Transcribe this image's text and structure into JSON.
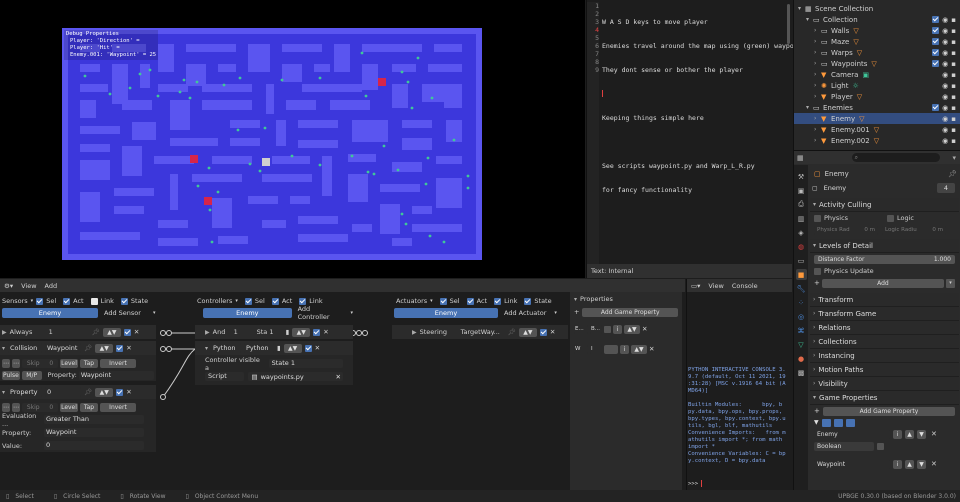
{
  "game_view": {
    "debug_title": "Debug Properties",
    "debug_lines": [
      "Player: 'Direction' =",
      "Player: 'Hit' =",
      "Enemy.001: 'Waypoint' = 25"
    ]
  },
  "text_editor": {
    "line_numbers": [
      "1",
      "2",
      "3",
      "4",
      "5",
      "6",
      "7",
      "8",
      "9"
    ],
    "lines": [
      "W A S D keys to move player",
      "Enemies travel around the map using (green) waypoints",
      "They dont sense or bother the player",
      "",
      "Keeping things simple here",
      "",
      "See scripts waypoint.py and Warp_L_R.py",
      "for fancy functionality",
      ""
    ],
    "footer": "Text: Internal"
  },
  "outliner": {
    "items": [
      {
        "label": "Scene Collection"
      },
      {
        "label": "Collection"
      },
      {
        "label": "Walls"
      },
      {
        "label": "Maze"
      },
      {
        "label": "Warps"
      },
      {
        "label": "Waypoints"
      },
      {
        "label": "Camera"
      },
      {
        "label": "Light"
      },
      {
        "label": "Player"
      },
      {
        "label": "Enemies"
      },
      {
        "label": "Enemy"
      },
      {
        "label": "Enemy.001"
      },
      {
        "label": "Enemy.002"
      }
    ]
  },
  "properties": {
    "search_placeholder": "",
    "object_name": "Enemy",
    "object_field": "Enemy",
    "users": "4",
    "sections": {
      "activity_culling": "Activity Culling",
      "physics": "Physics",
      "logic": "Logic",
      "physics_rad": "Physics Rad",
      "physics_rad_val": "0 m",
      "logic_radius": "Logic Radiu",
      "logic_radius_val": "0 m",
      "lod": "Levels of Detail",
      "distance_factor": "Distance Factor",
      "distance_factor_val": "1.000",
      "physics_update": "Physics Update",
      "add": "Add",
      "transform": "Transform",
      "transform_game": "Transform Game",
      "relations": "Relations",
      "collections": "Collections",
      "instancing": "Instancing",
      "motion_paths": "Motion Paths",
      "visibility": "Visibility",
      "game_properties": "Game Properties",
      "add_game_property": "Add Game Property",
      "gp_name": "Enemy",
      "gp_type": "Boolean",
      "gp_name2": "Waypoint"
    }
  },
  "logic_editor": {
    "menu": [
      "View",
      "Add"
    ],
    "sensors": {
      "header": "Sensors",
      "sel": "Sel",
      "act": "Act",
      "link": "Link",
      "state": "State",
      "object": "Enemy",
      "add": "Add Sensor",
      "always": {
        "label": "Always",
        "value": "1"
      },
      "collision": {
        "type": "Collision",
        "name": "Waypoint",
        "skip": "Skip",
        "skip_val": "0",
        "level": "Level",
        "tap": "Tap",
        "invert": "Invert",
        "pulse": "Pulse",
        "mp": "M/P",
        "property_label": "Property:",
        "property_val": "Waypoint"
      },
      "property": {
        "type": "Property",
        "value": "0",
        "skip": "Skip",
        "skip_val": "0",
        "level": "Level",
        "tap": "Tap",
        "invert": "Invert",
        "evaluation_label": "Evaluation ...",
        "evaluation_val": "Greater Than",
        "property_label": "Property:",
        "property_val": "Waypoint",
        "value_label": "Value:",
        "value_val": "0"
      }
    },
    "controllers": {
      "header": "Controllers",
      "sel": "Sel",
      "act": "Act",
      "link": "Link",
      "object": "Enemy",
      "add": "Add Controller",
      "and": {
        "type": "And",
        "value": "1",
        "state": "Sta 1"
      },
      "python": {
        "type": "Python",
        "name": "Python"
      },
      "visible_label": "Controller visible a",
      "state_val": "State 1",
      "script_label": "Script",
      "script_val": "waypoints.py"
    },
    "actuators": {
      "header": "Actuators",
      "sel": "Sel",
      "act": "Act",
      "link": "Link",
      "state": "State",
      "object": "Enemy",
      "add": "Add Actuator",
      "steering": {
        "type": "Steering",
        "name": "TargetWay..."
      }
    },
    "props_panel": {
      "header": "Properties",
      "add": "Add Game Property",
      "p1_name": "E...",
      "p1_type": "B...",
      "p2_name": "W",
      "p2_type": "I"
    }
  },
  "console": {
    "menu": [
      "View",
      "Console"
    ],
    "lines": [
      "PYTHON INTERACTIVE CONSOLE 3.",
      "9.7 (default, Oct 11 2021, 19",
      ":31:28) [MSC v.1916 64 bit (A",
      "MD64)]",
      "",
      "Builtin Modules:      bpy, b",
      "py.data, bpy.ops, bpy.props,",
      "bpy.types, bpy.context, bpy.u",
      "tils, bgl, blf, mathutils",
      "Convenience Imports:   from m",
      "athutils import *; from math",
      "import *",
      "Convenience Variables: C = bp",
      "y.context, D = bpy.data"
    ],
    "prompt": ">>> "
  },
  "status_bar": {
    "select": "Select",
    "circle_select": "Circle Select",
    "rotate_view": "Rotate View",
    "context_menu": "Object Context Menu",
    "version": "UPBGE 0.30.0 (based on Blender 3.0.0)"
  },
  "colors": {
    "maze_bg": "#3c37dc",
    "maze_wall": "#5a55f0",
    "selection": "#4772b3"
  }
}
